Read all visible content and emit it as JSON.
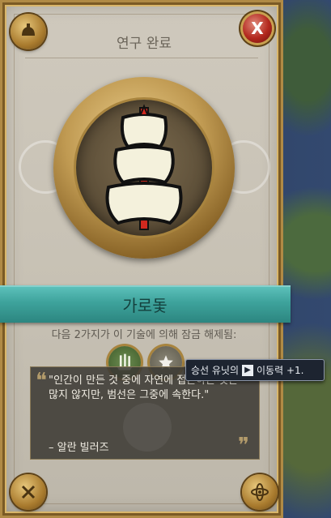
{
  "window": {
    "title": "연구 완료",
    "close_label": "X"
  },
  "tech": {
    "name": "가로돛",
    "icon": "sailing-ship-icon"
  },
  "unlocks": {
    "label": "다음 2가지가 이 기술에 의해 잠금 해제됨:",
    "items": [
      {
        "icon": "ship-unit-icon"
      },
      {
        "icon": "star-icon"
      }
    ]
  },
  "tooltip": {
    "prefix": "승선 유닛의",
    "icon": "movement-icon",
    "suffix": "이동력 +1."
  },
  "quote": {
    "text": "\"인간이 만든 것 중에 자연에 접근하는 것은 많지 않지만, 범선은 그중에 속한다.\"",
    "author": "– 알란 빌러즈"
  },
  "colors": {
    "accent_teal": "#3ea39c",
    "gold": "#b08a45",
    "close_red": "#b3281e"
  }
}
